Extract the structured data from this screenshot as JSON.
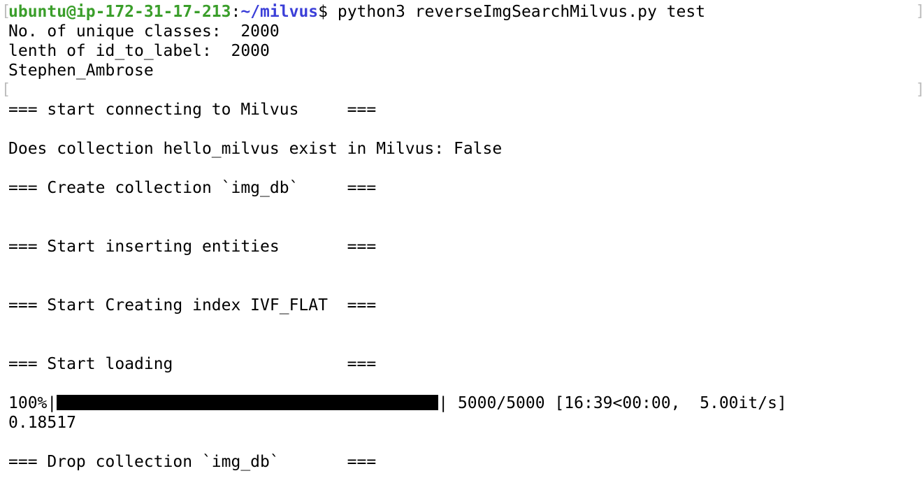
{
  "prompt": {
    "user_host": "ubuntu@ip-172-31-17-213",
    "colon": ":",
    "path": "~/milvus",
    "symbol": "$",
    "command": "python3 reverseImgSearchMilvus.py test"
  },
  "output": [
    "No. of unique classes:  2000",
    "lenth of id_to_label:  2000",
    "Stephen_Ambrose",
    "=== start connecting to Milvus     ===",
    "Does collection hello_milvus exist in Milvus: False",
    "=== Create collection `img_db`     ===",
    "=== Start inserting entities       ===",
    "=== Start Creating index IVF_FLAT  ===",
    "=== Start loading                  ==="
  ],
  "progress": {
    "percent_label": "100%",
    "pipe_left": "|",
    "pipe_right": "|",
    "fraction": 1.0,
    "stats": " 5000/5000 [16:39<00:00,  5.00it/s]"
  },
  "result_value": "0.18517",
  "final_line": "=== Drop collection `img_db`       ===",
  "colors": {
    "user_host": "#3a9e2a",
    "path": "#3b3fd8",
    "text": "#000000",
    "background": "#ffffff"
  }
}
